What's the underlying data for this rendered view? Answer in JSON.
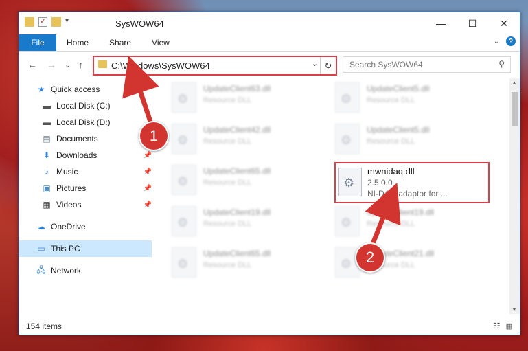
{
  "window": {
    "title": "SysWOW64",
    "controls": {
      "minimize": "—",
      "maximize": "☐",
      "close": "✕"
    }
  },
  "ribbon": {
    "tabs": [
      {
        "label": "File"
      },
      {
        "label": "Home"
      },
      {
        "label": "Share"
      },
      {
        "label": "View"
      }
    ],
    "help": "?"
  },
  "nav": {
    "back": "←",
    "forward": "→",
    "recent": "⌄",
    "up": "↑",
    "address_path": "C:\\Windows\\SysWOW64",
    "search_placeholder": "Search SysWOW64"
  },
  "sidebar": {
    "items": [
      {
        "label": "Quick access",
        "icon": "star-icon"
      },
      {
        "label": "Local Disk (C:)",
        "icon": "drive-icon"
      },
      {
        "label": "Local Disk (D:)",
        "icon": "drive-icon"
      },
      {
        "label": "Documents",
        "icon": "documents-icon"
      },
      {
        "label": "Downloads",
        "icon": "download-icon"
      },
      {
        "label": "Music",
        "icon": "music-icon"
      },
      {
        "label": "Pictures",
        "icon": "pictures-icon"
      },
      {
        "label": "Videos",
        "icon": "videos-icon"
      },
      {
        "label": "OneDrive",
        "icon": "cloud-icon"
      },
      {
        "label": "This PC",
        "icon": "computer-icon"
      },
      {
        "label": "Network",
        "icon": "network-icon"
      }
    ]
  },
  "files": [
    {
      "name": "UpdateClient63.dll",
      "desc": "Resource DLL"
    },
    {
      "name": "UpdateClient5.dll",
      "desc": "Resource DLL"
    },
    {
      "name": "UpdateClient42.dll",
      "desc": "Resource DLL"
    },
    {
      "name": "UpdateClient5.dll",
      "desc": "Resource DLL"
    },
    {
      "name": "UpdateClient65.dll",
      "desc": "Resource DLL"
    },
    {
      "name": "UpdateClient19.dll",
      "desc": "Resource DLL"
    },
    {
      "name": "UpdateClient19.dll",
      "desc": "Resource DLL"
    },
    {
      "name": "UpdateClient65.dll",
      "desc": "Resource DLL"
    },
    {
      "name": "UpdateClient21.dll",
      "desc": "Resource DLL"
    }
  ],
  "highlighted_file": {
    "name": "mwnidaq.dll",
    "version": "2.5.0.0",
    "desc": "NI-DAQ adaptor for ..."
  },
  "status": {
    "count": "154 items"
  },
  "badges": {
    "one": "1",
    "two": "2"
  },
  "colors": {
    "accent": "#1979ca",
    "highlight": "#d9414a"
  }
}
